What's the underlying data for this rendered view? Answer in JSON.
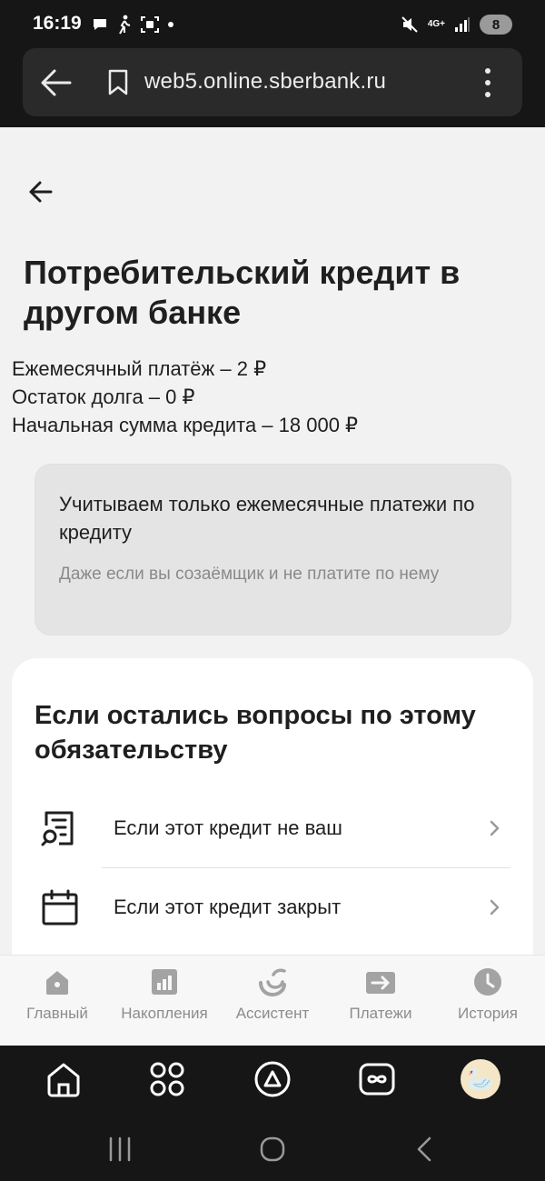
{
  "status_bar": {
    "time": "16:19",
    "network": "4G+",
    "battery": "8",
    "left_icons": [
      "chat-bubble-icon",
      "walking-person-icon",
      "screenshot-icon",
      "dot-icon"
    ],
    "right_icons": [
      "mute-icon",
      "signal-icon"
    ]
  },
  "browser": {
    "url": "web5.online.sberbank.ru"
  },
  "page": {
    "title": "Потребительский кредит в другом банке",
    "details": [
      "Ежемесячный платёж – 2 ₽",
      "Остаток долга – 0 ₽",
      "Начальная сумма кредита – 18 000 ₽"
    ],
    "info_card": {
      "title": "Учитываем только ежемесячные платежи по кредиту",
      "subtitle": "Даже если вы созаёмщик и не платите по нему"
    },
    "questions": {
      "title": "Если остались вопросы по этому обязательству",
      "items": [
        {
          "label": "Если этот кредит не ваш",
          "icon": "document-search-icon"
        },
        {
          "label": "Если этот кредит закрыт",
          "icon": "calendar-icon"
        }
      ]
    }
  },
  "tabbar": {
    "tabs": [
      {
        "label": "Главный",
        "icon": "home-icon"
      },
      {
        "label": "Накопления",
        "icon": "chart-icon"
      },
      {
        "label": "Ассистент",
        "icon": "assistant-icon"
      },
      {
        "label": "Платежи",
        "icon": "payment-arrow-icon"
      },
      {
        "label": "История",
        "icon": "clock-icon"
      }
    ]
  },
  "colors": {
    "page_bg": "#f2f2f2",
    "card_bg": "#e4e4e4",
    "text": "#1f1f1f",
    "muted": "#8a8a8a",
    "tab_icon": "#9a9a9a",
    "system_bar": "#161616"
  }
}
